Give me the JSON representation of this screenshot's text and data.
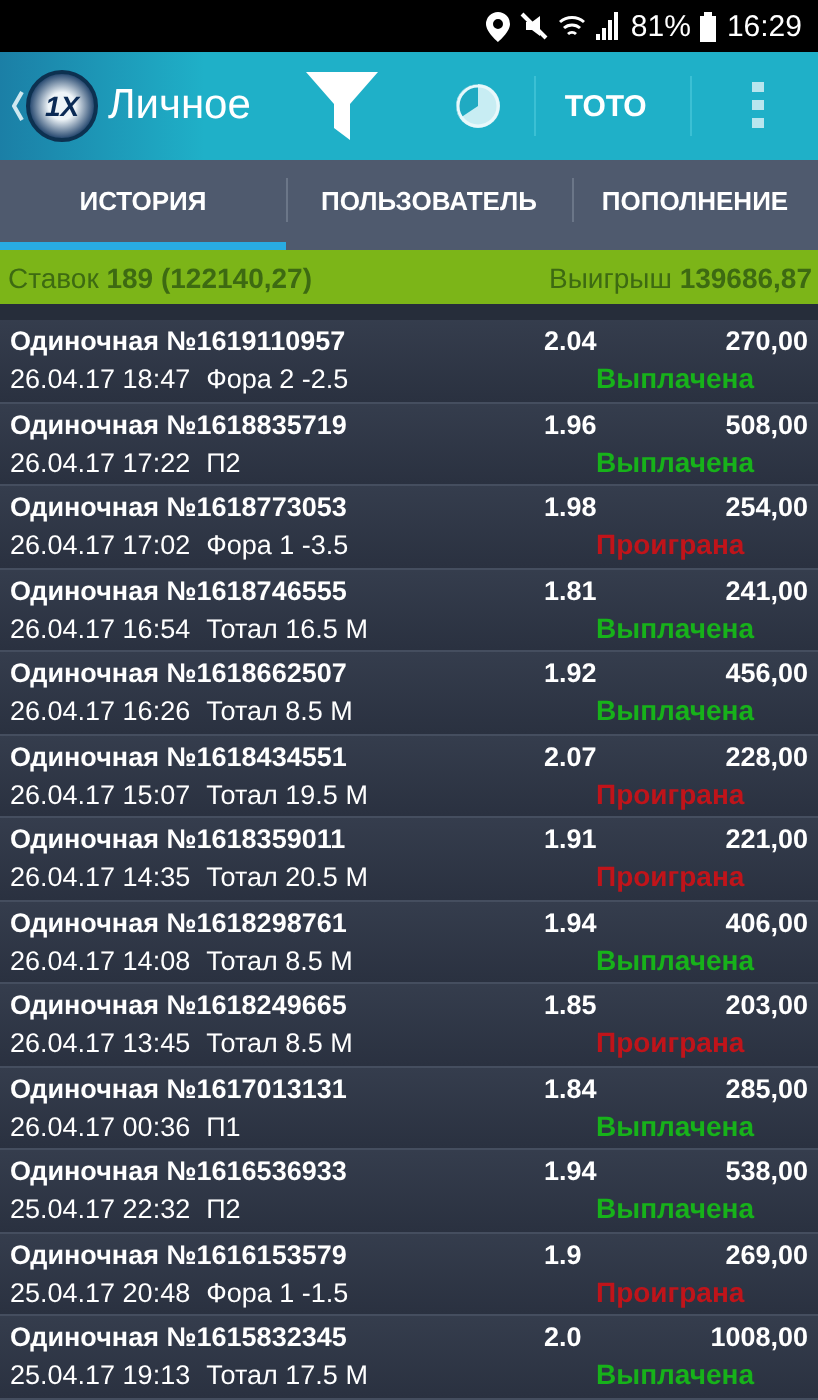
{
  "status_bar": {
    "battery": "81%",
    "time": "16:29"
  },
  "app_bar": {
    "logo_text": "1X",
    "title": "Личное",
    "toto": "ТОТО"
  },
  "tabs": [
    {
      "label": "ИСТОРИЯ",
      "selected": true
    },
    {
      "label": "ПОЛЬЗОВАТЕЛЬ",
      "selected": false
    },
    {
      "label": "ПОПОЛНЕНИЕ",
      "selected": false
    }
  ],
  "summary": {
    "bets": "Ставок **189 (122140,27)**",
    "winnings": "Выигрыш **139686,87**"
  },
  "bets": [
    {
      "title": "Одиночная №1619110957",
      "odds": "2.04",
      "amount": "270,00",
      "date": "26.04.17 18:47",
      "market": "Фора 2 -2.5",
      "status": "Выплачена",
      "kind": "won"
    },
    {
      "title": "Одиночная №1618835719",
      "odds": "1.96",
      "amount": "508,00",
      "date": "26.04.17 17:22",
      "market": "П2",
      "status": "Выплачена",
      "kind": "won"
    },
    {
      "title": "Одиночная №1618773053",
      "odds": "1.98",
      "amount": "254,00",
      "date": "26.04.17 17:02",
      "market": "Фора 1 -3.5",
      "status": "Проиграна",
      "kind": "lost"
    },
    {
      "title": "Одиночная №1618746555",
      "odds": "1.81",
      "amount": "241,00",
      "date": "26.04.17 16:54",
      "market": "Тотал 16.5 М",
      "status": "Выплачена",
      "kind": "won"
    },
    {
      "title": "Одиночная №1618662507",
      "odds": "1.92",
      "amount": "456,00",
      "date": "26.04.17 16:26",
      "market": "Тотал 8.5 М",
      "status": "Выплачена",
      "kind": "won"
    },
    {
      "title": "Одиночная №1618434551",
      "odds": "2.07",
      "amount": "228,00",
      "date": "26.04.17 15:07",
      "market": "Тотал 19.5 М",
      "status": "Проиграна",
      "kind": "lost"
    },
    {
      "title": "Одиночная №1618359011",
      "odds": "1.91",
      "amount": "221,00",
      "date": "26.04.17 14:35",
      "market": "Тотал 20.5 М",
      "status": "Проиграна",
      "kind": "lost"
    },
    {
      "title": "Одиночная №1618298761",
      "odds": "1.94",
      "amount": "406,00",
      "date": "26.04.17 14:08",
      "market": "Тотал 8.5 М",
      "status": "Выплачена",
      "kind": "won"
    },
    {
      "title": "Одиночная №1618249665",
      "odds": "1.85",
      "amount": "203,00",
      "date": "26.04.17 13:45",
      "market": "Тотал 8.5 М",
      "status": "Проиграна",
      "kind": "lost"
    },
    {
      "title": "Одиночная №1617013131",
      "odds": "1.84",
      "amount": "285,00",
      "date": "26.04.17 00:36",
      "market": "П1",
      "status": "Выплачена",
      "kind": "won"
    },
    {
      "title": "Одиночная №1616536933",
      "odds": "1.94",
      "amount": "538,00",
      "date": "25.04.17 22:32",
      "market": "П2",
      "status": "Выплачена",
      "kind": "won"
    },
    {
      "title": "Одиночная №1616153579",
      "odds": "1.9",
      "amount": "269,00",
      "date": "25.04.17 20:48",
      "market": "Фора 1 -1.5",
      "status": "Проиграна",
      "kind": "lost"
    },
    {
      "title": "Одиночная №1615832345",
      "odds": "2.0",
      "amount": "1008,00",
      "date": "25.04.17 19:13",
      "market": "Тотал 17.5 М",
      "status": "Выплачена",
      "kind": "won"
    }
  ]
}
